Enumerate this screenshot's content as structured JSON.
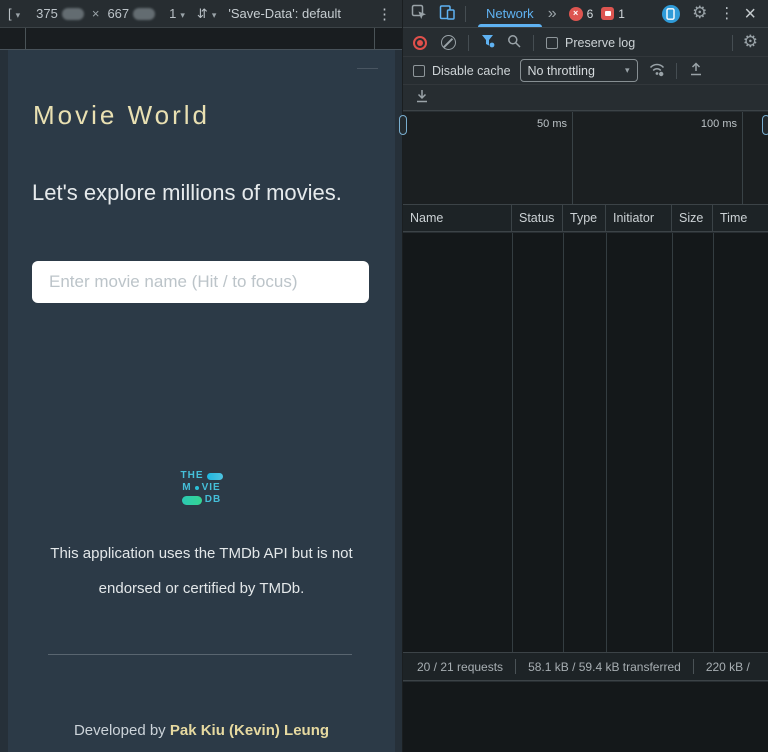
{
  "device_toolbar": {
    "dimensions_icon": "[",
    "width": "375",
    "times": "×",
    "height": "667",
    "zoom": "1",
    "save_data": "'Save-Data': default"
  },
  "icons": {
    "caret": "▾",
    "rotate": "⇵",
    "more_vert": "⋮",
    "more_tabs": "»",
    "gear": "⚙",
    "close": "×",
    "error_x": "×"
  },
  "app": {
    "title": "Movie World",
    "subtitle": "Let's explore millions of movies.",
    "search_placeholder": "Enter movie name (Hit / to focus)",
    "logo": {
      "line1": "THE",
      "line2_prefix": "M",
      "line2_suffix": "VIE",
      "line3": "DB"
    },
    "disclaimer_line1": "This application uses the TMDb API but is not",
    "disclaimer_line2": "endorsed or certified by TMDb.",
    "credit_prefix": "Developed by ",
    "credit_link": "Pak Kiu (Kevin) Leung"
  },
  "devtools": {
    "network_tab": "Network",
    "error_count": "6",
    "issue_count": "1",
    "preserve_log": "Preserve log",
    "disable_cache": "Disable cache",
    "throttling": "No throttling",
    "timeline_ticks": [
      "50 ms",
      "100 ms"
    ],
    "columns": [
      "Name",
      "Status",
      "Type",
      "Initiator",
      "Size",
      "Time"
    ],
    "summary": {
      "requests": "20 / 21 requests",
      "transferred": "58.1 kB / 59.4 kB transferred",
      "resources": "220 kB /"
    }
  },
  "colors": {
    "accent_blue": "#5fb2f2",
    "badge_red": "#dd5550",
    "record_red": "#e0504b",
    "app_background": "#2c3a47",
    "title_color": "#e9e0b2",
    "link_color": "#e6d9a0",
    "tmdb_blue": "#01b4e4",
    "tmdb_green": "#90cea1"
  }
}
